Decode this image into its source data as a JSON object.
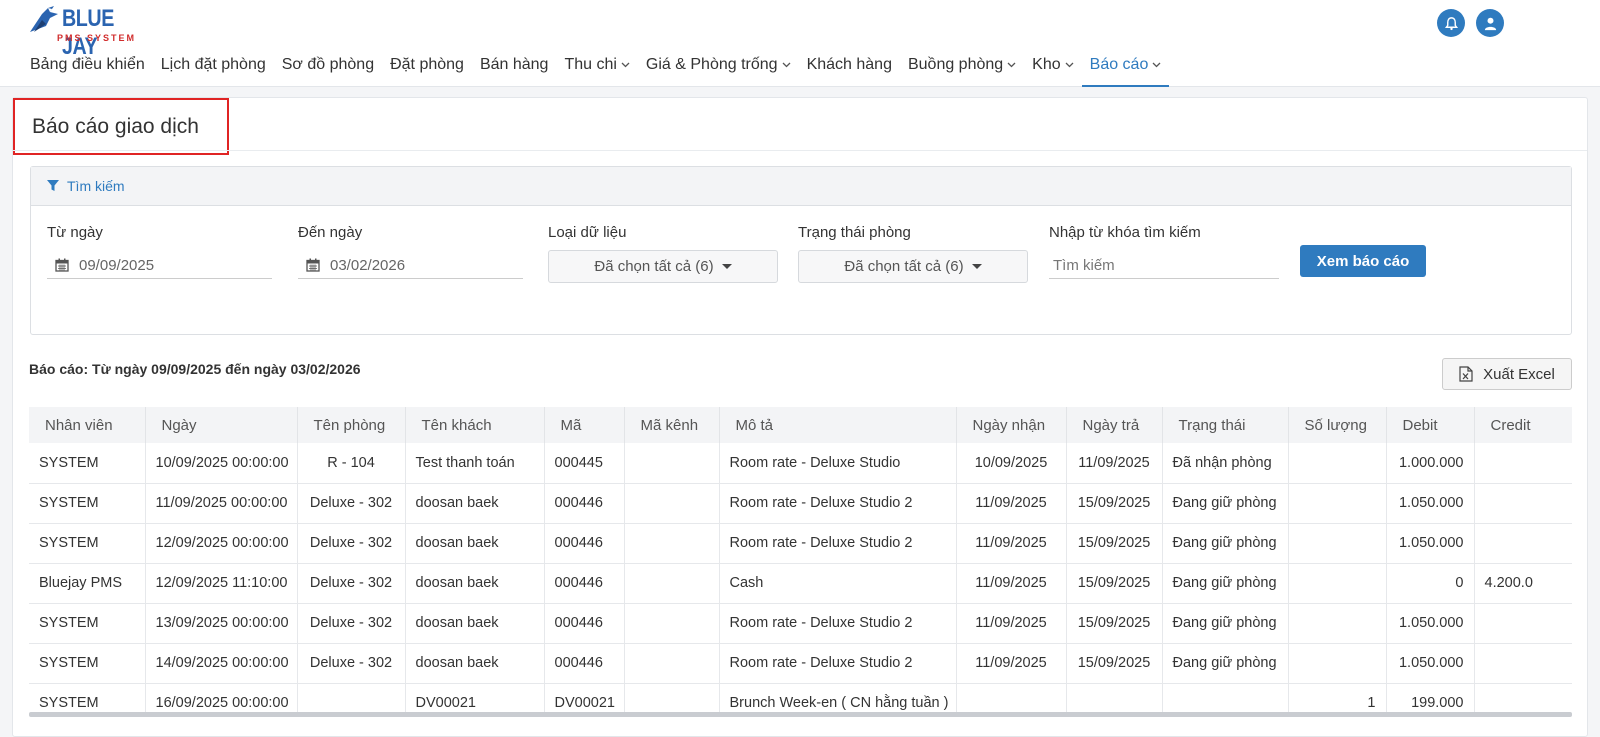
{
  "logo": {
    "name": "BLUE JAY",
    "sub": "PMS SYSTEM"
  },
  "header": {
    "icons": {
      "notifications": "bell-icon",
      "user": "user-icon"
    }
  },
  "nav": [
    {
      "label": "Bảng điều khiển",
      "dropdown": false,
      "active": false
    },
    {
      "label": "Lịch đặt phòng",
      "dropdown": false,
      "active": false
    },
    {
      "label": "Sơ đồ phòng",
      "dropdown": false,
      "active": false
    },
    {
      "label": "Đặt phòng",
      "dropdown": false,
      "active": false
    },
    {
      "label": "Bán hàng",
      "dropdown": false,
      "active": false
    },
    {
      "label": "Thu chi",
      "dropdown": true,
      "active": false
    },
    {
      "label": "Giá & Phòng trống",
      "dropdown": true,
      "active": false
    },
    {
      "label": "Khách hàng",
      "dropdown": false,
      "active": false
    },
    {
      "label": "Buồng phòng",
      "dropdown": true,
      "active": false
    },
    {
      "label": "Kho",
      "dropdown": true,
      "active": false
    },
    {
      "label": "Báo cáo",
      "dropdown": true,
      "active": true
    }
  ],
  "page": {
    "title": "Báo cáo giao dịch"
  },
  "search": {
    "heading": "Tìm kiếm",
    "from_label": "Từ ngày",
    "from_value": "09/09/2025",
    "to_label": "Đến ngày",
    "to_value": "03/02/2026",
    "type_label": "Loại dữ liệu",
    "type_value": "Đã chọn tất cả (6)",
    "status_label": "Trạng thái phòng",
    "status_value": "Đã chọn tất cả (6)",
    "keyword_label": "Nhập từ khóa tìm kiếm",
    "keyword_placeholder": "Tìm kiếm",
    "submit_label": "Xem báo cáo"
  },
  "report": {
    "range_text": "Báo cáo: Từ ngày 09/09/2025 đến ngày 03/02/2026",
    "export_label": "Xuất Excel"
  },
  "table": {
    "columns": [
      "Nhân viên",
      "Ngày",
      "Tên phòng",
      "Tên khách",
      "Mã",
      "Mã kênh",
      "Mô tả",
      "Ngày nhận",
      "Ngày trả",
      "Trạng thái",
      "Số lượng",
      "Debit",
      "Credit"
    ],
    "rows": [
      [
        "SYSTEM",
        "10/09/2025 00:00:00",
        "R - 104",
        "Test thanh toán",
        "000445",
        "",
        "Room rate - Deluxe Studio",
        "10/09/2025",
        "11/09/2025",
        "Đã nhận phòng",
        "",
        "1.000.000",
        ""
      ],
      [
        "SYSTEM",
        "11/09/2025 00:00:00",
        "Deluxe - 302",
        "doosan baek",
        "000446",
        "",
        "Room rate - Deluxe Studio 2",
        "11/09/2025",
        "15/09/2025",
        "Đang giữ phòng",
        "",
        "1.050.000",
        ""
      ],
      [
        "SYSTEM",
        "12/09/2025 00:00:00",
        "Deluxe - 302",
        "doosan baek",
        "000446",
        "",
        "Room rate - Deluxe Studio 2",
        "11/09/2025",
        "15/09/2025",
        "Đang giữ phòng",
        "",
        "1.050.000",
        ""
      ],
      [
        "Bluejay PMS",
        "12/09/2025 11:10:00",
        "Deluxe - 302",
        "doosan baek",
        "000446",
        "",
        "Cash",
        "11/09/2025",
        "15/09/2025",
        "Đang giữ phòng",
        "",
        "0",
        "4.200.0"
      ],
      [
        "SYSTEM",
        "13/09/2025 00:00:00",
        "Deluxe - 302",
        "doosan baek",
        "000446",
        "",
        "Room rate - Deluxe Studio 2",
        "11/09/2025",
        "15/09/2025",
        "Đang giữ phòng",
        "",
        "1.050.000",
        ""
      ],
      [
        "SYSTEM",
        "14/09/2025 00:00:00",
        "Deluxe - 302",
        "doosan baek",
        "000446",
        "",
        "Room rate - Deluxe Studio 2",
        "11/09/2025",
        "15/09/2025",
        "Đang giữ phòng",
        "",
        "1.050.000",
        ""
      ],
      [
        "SYSTEM",
        "16/09/2025 00:00:00",
        "",
        "DV00021",
        "DV00021",
        "",
        "Brunch Week-en ( CN hằng tuần )",
        "",
        "",
        "",
        "1",
        "199.000",
        ""
      ]
    ]
  },
  "colors": {
    "accent": "#2f7bbf",
    "highlight_border": "#e02424",
    "logo_red": "#d12c2c"
  }
}
